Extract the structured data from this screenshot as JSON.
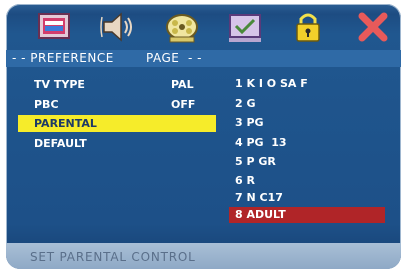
{
  "menu": {
    "tabs": [
      {
        "name": "tv-setup",
        "icon": "tv-screen-icon"
      },
      {
        "name": "audio",
        "icon": "speaker-icon"
      },
      {
        "name": "video",
        "icon": "film-reel-icon"
      },
      {
        "name": "preference",
        "icon": "checkbox-screen-icon"
      },
      {
        "name": "password",
        "icon": "padlock-icon"
      },
      {
        "name": "exit",
        "icon": "close-x-icon"
      }
    ],
    "selected_tab": "preference"
  },
  "title": {
    "prefix": "- - PREFERENCE",
    "suffix": "PAGE  - -"
  },
  "settings": [
    {
      "label": "TV TYPE",
      "value": "PAL"
    },
    {
      "label": "PBC",
      "value": "OFF"
    },
    {
      "label": "PARENTAL",
      "value": ""
    },
    {
      "label": "DEFAULT",
      "value": ""
    }
  ],
  "selected_setting": "PARENTAL",
  "parental_options": [
    "1 K I O SA F",
    "2 G",
    "3 PG",
    "4 PG  13",
    "5 P GR",
    "6 R",
    "7 N C17",
    "8 ADULT"
  ],
  "selected_option": "8 ADULT",
  "status": "SET PARENTAL CONTROL",
  "colors": {
    "background": "#1d5088",
    "title_bar": "#2f6aa6",
    "highlight_setting": "#f6ec2a",
    "highlight_option": "#b02528",
    "footer": "#9fb6cf"
  }
}
